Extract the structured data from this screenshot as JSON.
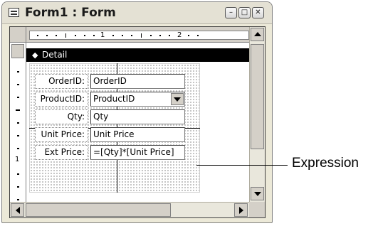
{
  "window": {
    "title": "Form1 : Form",
    "buttons": {
      "minimize": "–",
      "maximize": "□",
      "close": "✕"
    }
  },
  "ruler": {
    "horizontal_numbers": [
      "1",
      "2"
    ],
    "vertical_numbers": [
      "1"
    ]
  },
  "section": {
    "title": "Detail",
    "icon": "section-selector-icon"
  },
  "form_rows": [
    {
      "label": "OrderID:",
      "field": "OrderID",
      "type": "text"
    },
    {
      "label": "ProductID:",
      "field": "ProductID",
      "type": "combo"
    },
    {
      "label": "Qty:",
      "field": "Qty",
      "type": "text"
    },
    {
      "label": "Unit Price:",
      "field": "Unit Price",
      "type": "text"
    },
    {
      "label": "Ext Price:",
      "field": "=[Qty]*[Unit Price]",
      "type": "text"
    }
  ],
  "callout": {
    "text": "Expression"
  },
  "colors": {
    "window_bg": "#ece9d8",
    "section_bar": "#000000",
    "ruler_bg": "#d4d0c8"
  }
}
